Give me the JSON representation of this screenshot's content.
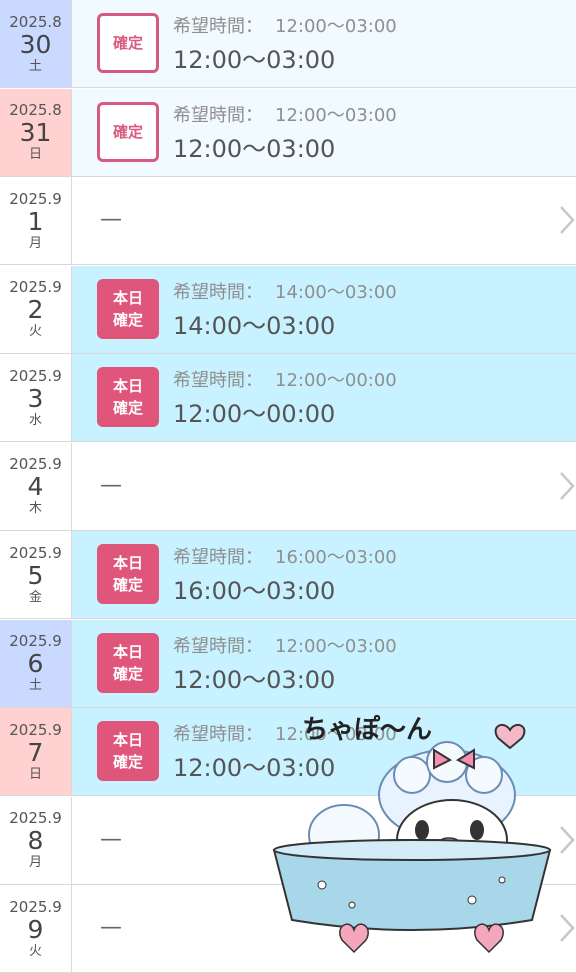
{
  "wish_label": "希望時間：",
  "rows": [
    {
      "ym": "2025.8",
      "day": "30",
      "weekday": "土",
      "kind": "sat",
      "status": "confirmed",
      "badge": [
        "確定"
      ],
      "wish": "12:00〜03:00",
      "time": "12:00〜03:00"
    },
    {
      "ym": "2025.8",
      "day": "31",
      "weekday": "日",
      "kind": "sun",
      "status": "confirmed",
      "badge": [
        "確定"
      ],
      "wish": "12:00〜03:00",
      "time": "12:00〜03:00"
    },
    {
      "ym": "2025.9",
      "day": "1",
      "weekday": "月",
      "kind": "normal",
      "status": "none",
      "dash": "—"
    },
    {
      "ym": "2025.9",
      "day": "2",
      "weekday": "火",
      "kind": "normal",
      "status": "today",
      "badge": [
        "本日",
        "確定"
      ],
      "wish": "14:00〜03:00",
      "time": "14:00〜03:00"
    },
    {
      "ym": "2025.9",
      "day": "3",
      "weekday": "水",
      "kind": "normal",
      "status": "today",
      "badge": [
        "本日",
        "確定"
      ],
      "wish": "12:00〜00:00",
      "time": "12:00〜00:00"
    },
    {
      "ym": "2025.9",
      "day": "4",
      "weekday": "木",
      "kind": "normal",
      "status": "none",
      "dash": "—"
    },
    {
      "ym": "2025.9",
      "day": "5",
      "weekday": "金",
      "kind": "normal",
      "status": "today",
      "badge": [
        "本日",
        "確定"
      ],
      "wish": "16:00〜03:00",
      "time": "16:00〜03:00"
    },
    {
      "ym": "2025.9",
      "day": "6",
      "weekday": "土",
      "kind": "sat",
      "status": "today",
      "badge": [
        "本日",
        "確定"
      ],
      "wish": "12:00〜03:00",
      "time": "12:00〜03:00"
    },
    {
      "ym": "2025.9",
      "day": "7",
      "weekday": "日",
      "kind": "sun",
      "status": "today",
      "badge": [
        "本日",
        "確定"
      ],
      "wish": "12:00〜03:00",
      "time": "12:00〜03:00"
    },
    {
      "ym": "2025.9",
      "day": "8",
      "weekday": "月",
      "kind": "normal",
      "status": "none",
      "dash": "—"
    },
    {
      "ym": "2025.9",
      "day": "9",
      "weekday": "火",
      "kind": "normal",
      "status": "none",
      "dash": "—"
    }
  ],
  "sticker": {
    "text": "ちゃぽ〜ん"
  }
}
